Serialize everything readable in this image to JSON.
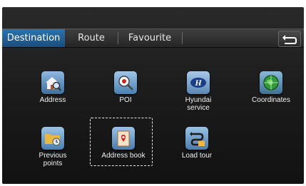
{
  "tabs": [
    "Destination",
    "Route",
    "Favourite"
  ],
  "tiles": {
    "address": "Address",
    "poi": "POI",
    "hyundai_line1": "Hyundai",
    "hyundai_line2": "service",
    "coordinates": "Coordinates",
    "previous_line1": "Previous",
    "previous_line2": "points",
    "address_book": "Address book",
    "load_tour": "Load tour"
  },
  "icons": {
    "address": "house-search-icon",
    "poi": "map-pin-search-icon",
    "hyundai": "hyundai-logo-icon",
    "coordinates": "globe-compass-icon",
    "previous_points": "folder-history-icon",
    "address_book": "address-book-icon",
    "load_tour": "route-folder-icon",
    "back": "back-arrow-icon"
  },
  "colors": {
    "active_tab": "#2a6ea8",
    "background": "#1c1c1c",
    "text": "#f0f0f0"
  }
}
